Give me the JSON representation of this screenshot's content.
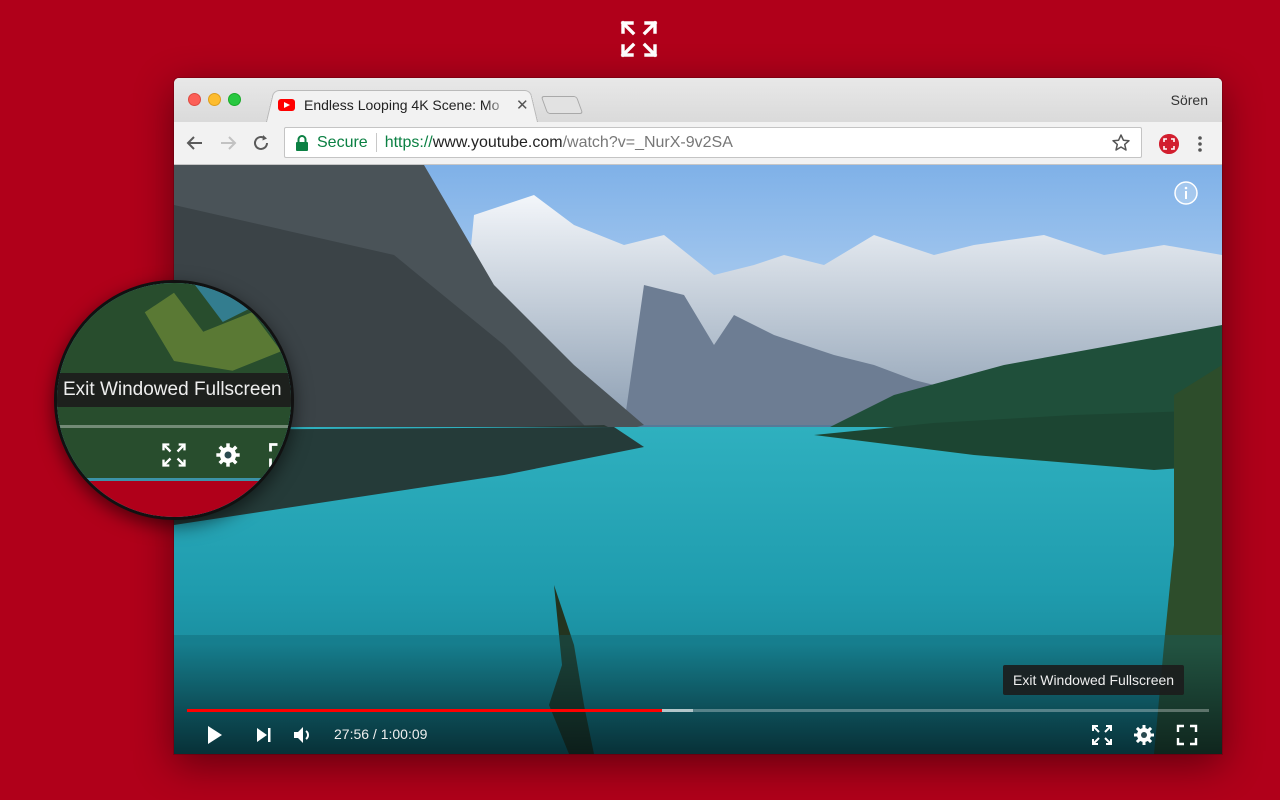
{
  "colors": {
    "background": "#b0001a",
    "accent_red": "#ff0000",
    "secure_green": "#0b8043"
  },
  "top": {
    "icon": "windowed-fullscreen-icon"
  },
  "browser": {
    "tab": {
      "title": "Endless Looping 4K Scene: Mo",
      "favicon": "youtube-icon",
      "close": "✕"
    },
    "profile": "Sören",
    "nav": {
      "back": "back-icon",
      "forward": "forward-icon",
      "reload": "reload-icon"
    },
    "omnibox": {
      "secure_label": "Secure",
      "url_scheme": "https://",
      "url_host": "www.youtube.com",
      "url_path": "/watch?v=_NurX-9v2SA"
    }
  },
  "player": {
    "time_display": "27:56 / 1:00:09",
    "tooltip": "Exit Windowed Fullscreen",
    "progress_played": 0.465,
    "progress_loaded": 0.495,
    "controls": [
      "play-icon",
      "next-icon",
      "volume-icon",
      "windowed-fullscreen-icon",
      "settings-icon",
      "fullscreen-icon"
    ]
  },
  "magnifier": {
    "tooltip": "Exit Windowed Fullscreen"
  }
}
